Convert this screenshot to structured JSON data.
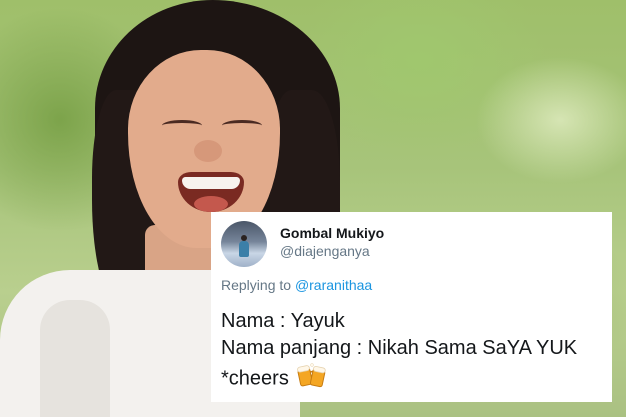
{
  "tweet": {
    "display_name": "Gombal Mukiyo",
    "handle": "@diajenganya",
    "replying_prefix": "Replying to",
    "replying_to": "@raranithaa",
    "lines": [
      "Nama : Yayuk",
      "Nama panjang : Nikah Sama SaYA YUK",
      "*cheers"
    ],
    "emoji": "clinking-beer-mugs-icon"
  },
  "colors": {
    "link": "#1b95e0",
    "secondary_text": "#657786",
    "primary_text": "#14171a",
    "card_background": "#ffffff"
  }
}
